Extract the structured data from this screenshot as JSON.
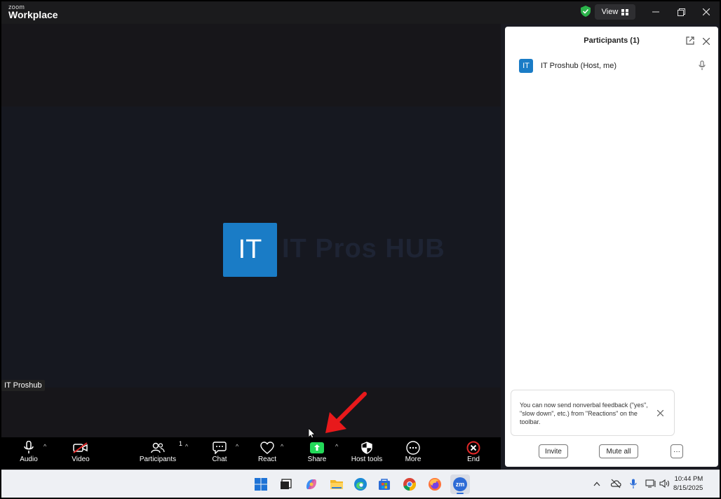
{
  "titlebar": {
    "logo_small": "zoom",
    "logo_big": "Workplace",
    "view_label": "View"
  },
  "video": {
    "avatar_initials": "IT",
    "watermark": "IT Pros HUB",
    "name_tag": "IT Proshub"
  },
  "toolbar": {
    "audio": "Audio",
    "video": "Video",
    "participants": "Participants",
    "participants_count": "1",
    "chat": "Chat",
    "react": "React",
    "share": "Share",
    "host_tools": "Host tools",
    "more": "More",
    "end": "End"
  },
  "panel": {
    "title": "Participants (1)",
    "participants": [
      {
        "initials": "IT",
        "name": "IT Proshub (Host, me)"
      }
    ],
    "tip": "You can now send nonverbal feedback (\"yes\", \"slow down\", etc.) from \"Reactions\" on the toolbar.",
    "invite": "Invite",
    "mute_all": "Mute all",
    "more": "···"
  },
  "taskbar": {
    "time": "10:44 PM",
    "date": "8/15/2025",
    "zoom_icon_label": "zm"
  },
  "colors": {
    "accent_blue": "#1a7cc6",
    "share_green": "#23d959",
    "end_red": "#e02828",
    "annotation_arrow": "#e8191b"
  }
}
